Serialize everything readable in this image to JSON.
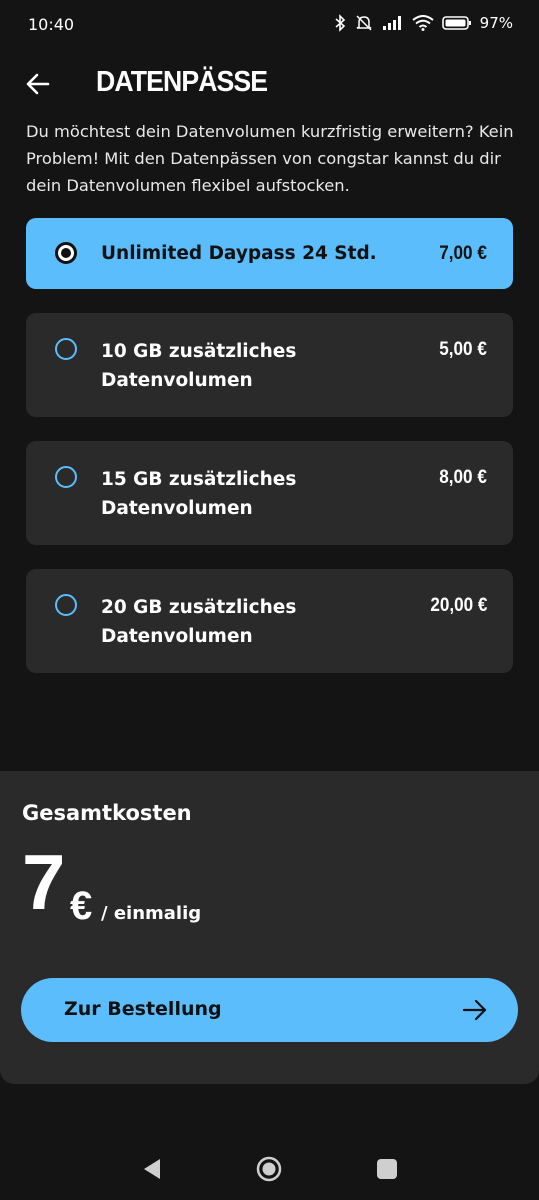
{
  "status_bar": {
    "time": "10:40",
    "battery_percent": "97%",
    "icons": [
      "bluetooth-icon",
      "mute-icon",
      "signal-icon",
      "wifi-icon",
      "battery-icon"
    ]
  },
  "header": {
    "title": "DATENPÄSSE",
    "back_icon": "arrow-left-icon"
  },
  "intro_text": "Du möchtest dein Datenvolumen kurzfristig erweitern? Kein Problem! Mit den Datenpässen von congstar kannst du dir dein Datenvolumen flexibel aufstocken.",
  "options": [
    {
      "label": "Unlimited Daypass 24 Std.",
      "price": "7,00 €",
      "selected": true
    },
    {
      "label": "10 GB zusätzliches Datenvolumen",
      "price": "5,00 €",
      "selected": false
    },
    {
      "label": "15 GB zusätzliches Datenvolumen",
      "price": "8,00 €",
      "selected": false
    },
    {
      "label": "20 GB zusätzliches Datenvolumen",
      "price": "20,00 €",
      "selected": false
    }
  ],
  "summary": {
    "title": "Gesamtkosten",
    "amount": "7",
    "currency": "€",
    "period": "/ einmalig",
    "order_button_label": "Zur Bestellung",
    "order_icon": "arrow-right-icon"
  },
  "colors": {
    "background": "#141414",
    "card": "#2a2a2a",
    "accent": "#5bbdfc"
  },
  "navigation": {
    "icons": [
      "nav-back-icon",
      "nav-home-icon",
      "nav-recents-icon"
    ]
  }
}
